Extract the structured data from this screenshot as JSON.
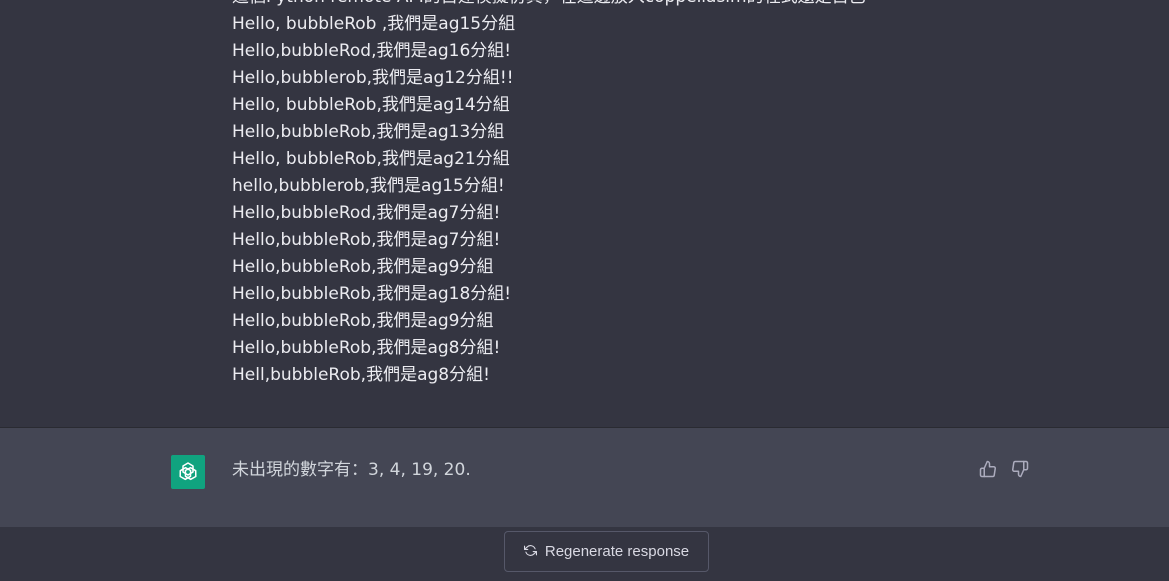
{
  "conversation": {
    "user_message": {
      "lines": [
        "這個Python remote API的自建模擬仿真，在這邊放入coppeliasim的程式還是自己",
        "Hello, bubbleRob ,我們是ag15分組",
        "Hello,bubbleRod,我們是ag16分組!",
        "Hello,bubblerob,我們是ag12分組!!",
        "Hello, bubbleRob,我們是ag14分組",
        "Hello,bubbleRob,我們是ag13分組",
        "Hello, bubbleRob,我們是ag21分組",
        "hello,bubblerob,我們是ag15分組!",
        "Hello,bubbleRod,我們是ag7分組!",
        "Hello,bubbleRob,我們是ag7分組!",
        "Hello,bubbleRob,我們是ag9分組",
        "Hello,bubbleRob,我們是ag18分組!",
        "Hello,bubbleRob,我們是ag9分組",
        "Hello,bubbleRob,我們是ag8分組!",
        "Hell,bubbleRob,我們是ag8分組!"
      ]
    },
    "assistant_message": {
      "avatar_icon": "openai-logo-icon",
      "text": "未出現的數字有：3, 4, 19, 20.",
      "thumbs_up_icon": "thumbs-up-icon",
      "thumbs_down_icon": "thumbs-down-icon"
    }
  },
  "footer": {
    "regenerate_label": "Regenerate response",
    "regenerate_icon": "refresh-icon"
  },
  "colors": {
    "background": "#343541",
    "assistant_background": "#444654",
    "avatar": "#10a37f",
    "text": "#ececf1"
  }
}
